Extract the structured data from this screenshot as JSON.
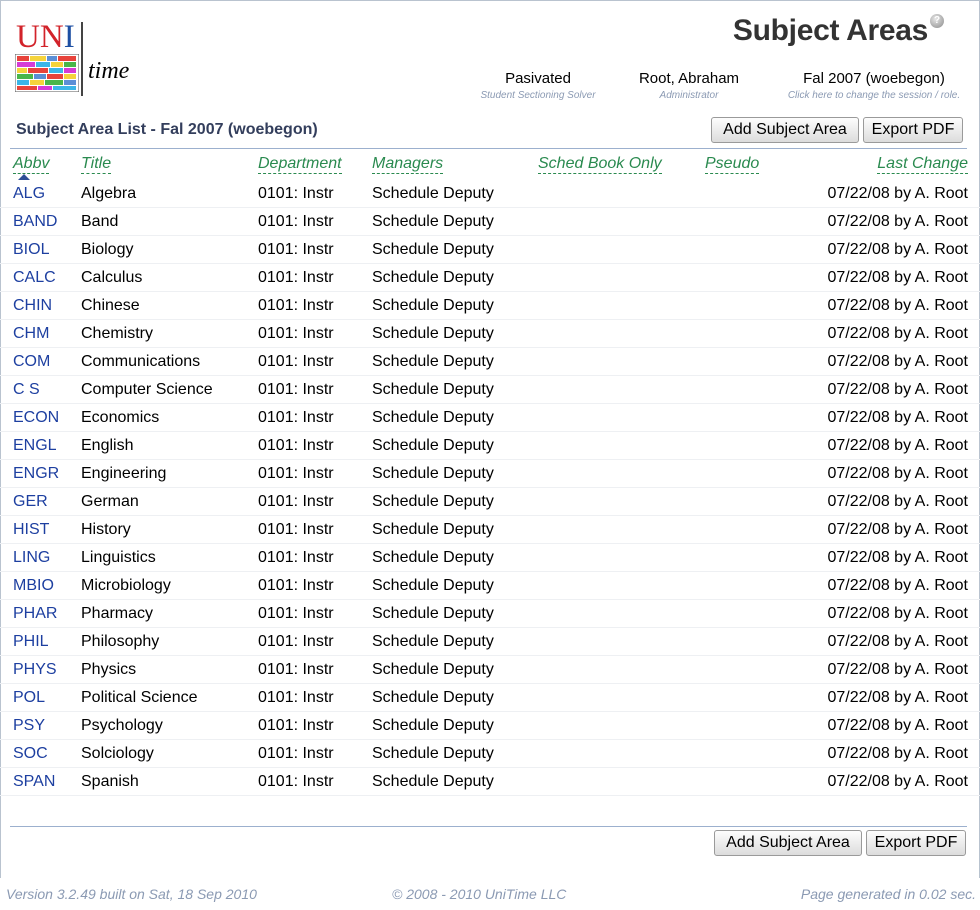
{
  "app": {
    "logo_text_u": "U",
    "logo_text_n": "N",
    "logo_text_i": "I",
    "logo_text_time": "time"
  },
  "header": {
    "page_title": "Subject Areas",
    "help_icon": "?",
    "solver_status": "Pasivated",
    "solver_label": "Student Sectioning Solver",
    "user_name": "Root, Abraham",
    "user_role": "Administrator",
    "session_name": "Fal 2007 (woebegon)",
    "session_hint": "Click here to change the session / role."
  },
  "section": {
    "title": "Subject Area List - Fal 2007 (woebegon)",
    "add_button": "Add Subject Area",
    "export_button": "Export PDF"
  },
  "columns": {
    "abbv": "Abbv",
    "title": "Title",
    "department": "Department",
    "managers": "Managers",
    "sched_book_only": "Sched Book Only",
    "pseudo": "Pseudo",
    "last_change": "Last Change"
  },
  "rows": [
    {
      "abbv": "ALG",
      "title": "Algebra",
      "dept": "0101: Instr",
      "mgr": "Schedule Deputy",
      "last": "07/22/08 by A. Root"
    },
    {
      "abbv": "BAND",
      "title": "Band",
      "dept": "0101: Instr",
      "mgr": "Schedule Deputy",
      "last": "07/22/08 by A. Root"
    },
    {
      "abbv": "BIOL",
      "title": "Biology",
      "dept": "0101: Instr",
      "mgr": "Schedule Deputy",
      "last": "07/22/08 by A. Root"
    },
    {
      "abbv": "CALC",
      "title": "Calculus",
      "dept": "0101: Instr",
      "mgr": "Schedule Deputy",
      "last": "07/22/08 by A. Root"
    },
    {
      "abbv": "CHIN",
      "title": "Chinese",
      "dept": "0101: Instr",
      "mgr": "Schedule Deputy",
      "last": "07/22/08 by A. Root"
    },
    {
      "abbv": "CHM",
      "title": "Chemistry",
      "dept": "0101: Instr",
      "mgr": "Schedule Deputy",
      "last": "07/22/08 by A. Root"
    },
    {
      "abbv": "COM",
      "title": "Communications",
      "dept": "0101: Instr",
      "mgr": "Schedule Deputy",
      "last": "07/22/08 by A. Root"
    },
    {
      "abbv": "C S",
      "title": "Computer Science",
      "dept": "0101: Instr",
      "mgr": "Schedule Deputy",
      "last": "07/22/08 by A. Root"
    },
    {
      "abbv": "ECON",
      "title": "Economics",
      "dept": "0101: Instr",
      "mgr": "Schedule Deputy",
      "last": "07/22/08 by A. Root"
    },
    {
      "abbv": "ENGL",
      "title": "English",
      "dept": "0101: Instr",
      "mgr": "Schedule Deputy",
      "last": "07/22/08 by A. Root"
    },
    {
      "abbv": "ENGR",
      "title": "Engineering",
      "dept": "0101: Instr",
      "mgr": "Schedule Deputy",
      "last": "07/22/08 by A. Root"
    },
    {
      "abbv": "GER",
      "title": "German",
      "dept": "0101: Instr",
      "mgr": "Schedule Deputy",
      "last": "07/22/08 by A. Root"
    },
    {
      "abbv": "HIST",
      "title": "History",
      "dept": "0101: Instr",
      "mgr": "Schedule Deputy",
      "last": "07/22/08 by A. Root"
    },
    {
      "abbv": "LING",
      "title": "Linguistics",
      "dept": "0101: Instr",
      "mgr": "Schedule Deputy",
      "last": "07/22/08 by A. Root"
    },
    {
      "abbv": "MBIO",
      "title": "Microbiology",
      "dept": "0101: Instr",
      "mgr": "Schedule Deputy",
      "last": "07/22/08 by A. Root"
    },
    {
      "abbv": "PHAR",
      "title": "Pharmacy",
      "dept": "0101: Instr",
      "mgr": "Schedule Deputy",
      "last": "07/22/08 by A. Root"
    },
    {
      "abbv": "PHIL",
      "title": "Philosophy",
      "dept": "0101: Instr",
      "mgr": "Schedule Deputy",
      "last": "07/22/08 by A. Root"
    },
    {
      "abbv": "PHYS",
      "title": "Physics",
      "dept": "0101: Instr",
      "mgr": "Schedule Deputy",
      "last": "07/22/08 by A. Root"
    },
    {
      "abbv": "POL",
      "title": "Political Science",
      "dept": "0101: Instr",
      "mgr": "Schedule Deputy",
      "last": "07/22/08 by A. Root"
    },
    {
      "abbv": "PSY",
      "title": "Psychology",
      "dept": "0101: Instr",
      "mgr": "Schedule Deputy",
      "last": "07/22/08 by A. Root"
    },
    {
      "abbv": "SOC",
      "title": "Solciology",
      "dept": "0101: Instr",
      "mgr": "Schedule Deputy",
      "last": "07/22/08 by A. Root"
    },
    {
      "abbv": "SPAN",
      "title": "Spanish",
      "dept": "0101: Instr",
      "mgr": "Schedule Deputy",
      "last": "07/22/08 by A. Root"
    }
  ],
  "footer": {
    "version": "Version 3.2.49 built on Sat, 18 Sep 2010",
    "copyright": "© 2008 - 2010 UniTime LLC",
    "generated": "Page generated in 0.02 sec."
  },
  "colors": {
    "link_blue": "#1d3fa0",
    "header_green": "#2a8a4f",
    "section_title": "#333e5c",
    "muted_text": "#8b9ab3",
    "rule": "#9cb0ce"
  }
}
